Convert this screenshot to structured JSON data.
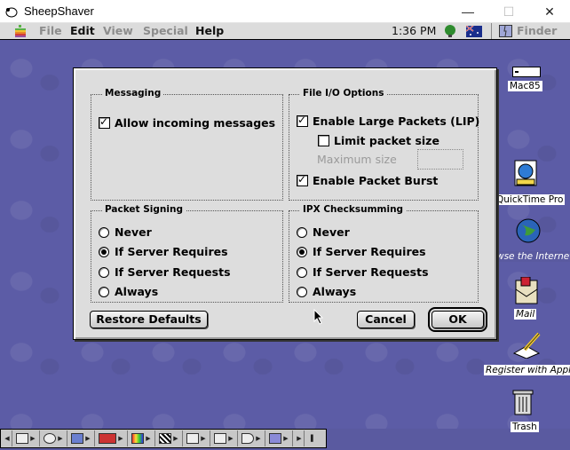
{
  "window": {
    "title": "SheepShaver"
  },
  "menubar": {
    "items": [
      "File",
      "Edit",
      "View",
      "Special",
      "Help"
    ],
    "clock": "1:36 PM",
    "app_name": "Finder"
  },
  "desktop": {
    "icons": [
      {
        "label": "Mac85"
      },
      {
        "label": "QuickTime Pro"
      },
      {
        "label": "wse the Internet"
      },
      {
        "label": "Mail"
      },
      {
        "label": "Register with Apple"
      },
      {
        "label": "Trash"
      }
    ]
  },
  "dialog": {
    "messaging": {
      "title": "Messaging",
      "allow_incoming": {
        "label": "Allow incoming messages",
        "checked": true
      }
    },
    "file_io": {
      "title": "File I/O Options",
      "large_packets": {
        "label": "Enable Large Packets (LIP)",
        "checked": true
      },
      "limit_size": {
        "label": "Limit packet size",
        "checked": false
      },
      "max_size_label": "Maximum size",
      "max_size_value": "",
      "packet_burst": {
        "label": "Enable Packet Burst",
        "checked": true
      }
    },
    "packet_signing": {
      "title": "Packet Signing",
      "options": [
        "Never",
        "If Server Requires",
        "If Server Requests",
        "Always"
      ],
      "selected": "If Server Requires"
    },
    "ipx_checksumming": {
      "title": "IPX Checksumming",
      "options": [
        "Never",
        "If Server Requires",
        "If Server Requests",
        "Always"
      ],
      "selected": "If Server Requires"
    },
    "buttons": {
      "restore": "Restore Defaults",
      "cancel": "Cancel",
      "ok": "OK"
    }
  }
}
